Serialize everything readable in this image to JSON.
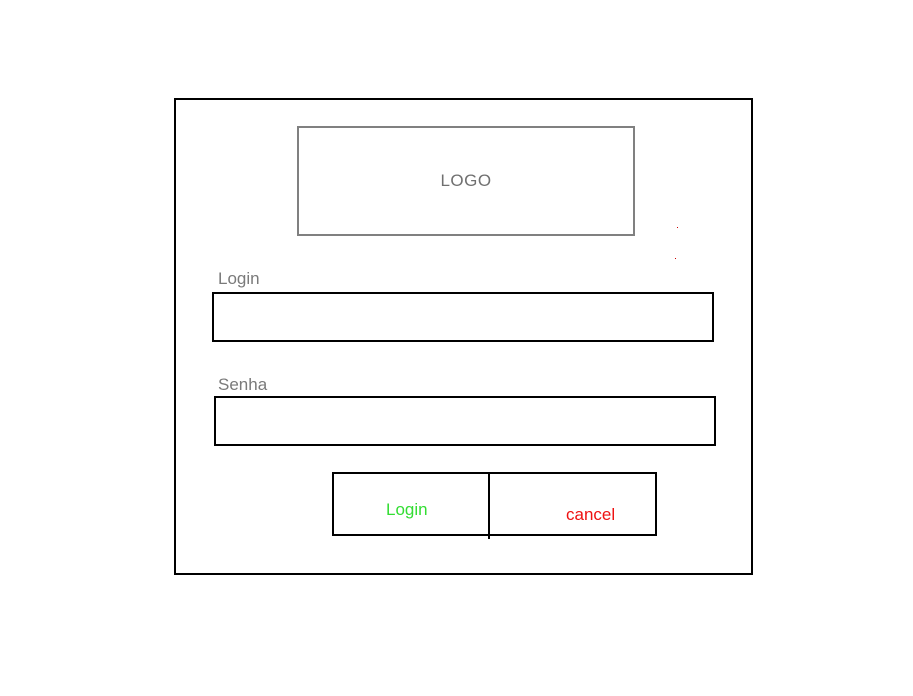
{
  "logo": {
    "text": "LOGO"
  },
  "form": {
    "login_label": "Login",
    "login_value": "",
    "password_label": "Senha",
    "password_value": ""
  },
  "buttons": {
    "login_label": "Login",
    "cancel_label": "cancel"
  },
  "colors": {
    "login_text": "#33dd33",
    "cancel_text": "#ee1111",
    "label_text": "#7a7a7a",
    "border": "#000000"
  }
}
